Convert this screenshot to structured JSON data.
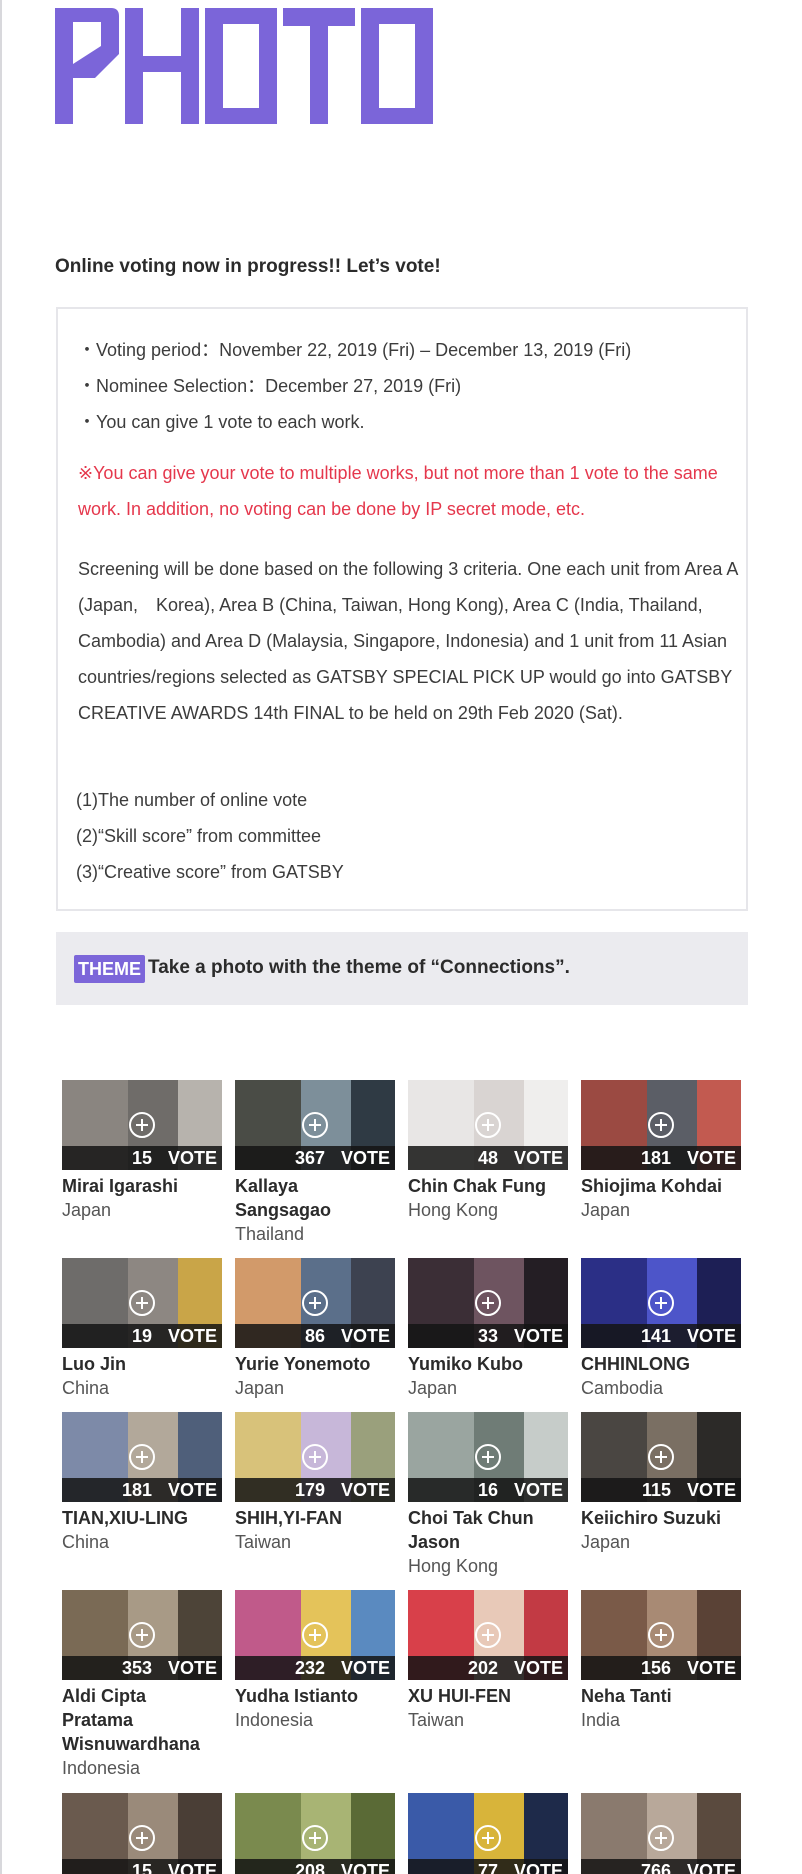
{
  "header": {
    "logo_text": "PHOTO",
    "logo_color": "#7b65d9"
  },
  "intro_text": "Online voting now in progress!! Let’s vote!",
  "info": {
    "period": "・Voting period：November 22, 2019 (Fri) – December 13, 2019 (Fri)",
    "selection": "・Nominee Selection：December 27, 2019 (Fri)",
    "one_vote": "・You can give 1 vote to each work.",
    "warning": "※You can give your vote to multiple works, but not more than 1 vote to the same work. In addition, no voting can be done by IP secret mode, etc.",
    "screening": "Screening will be done based on the following 3 criteria. One each unit from Area A (Japan,　Korea), Area B (China, Taiwan, Hong Kong), Area C (India, Thailand, Cambodia) and Area D (Malaysia, Singapore, Indonesia) and 1 unit from 11 Asian countries/regions selected as GATSBY SPECIAL PICK UP would go into GATSBY CREATIVE AWARDS 14th FINAL to be held on 29th Feb 2020 (Sat).",
    "criteria": [
      "(1)The number of online vote",
      "(2)“Skill score” from committee",
      "(3)“Creative score” from GATSBY"
    ],
    "warning_color": "#e5374c"
  },
  "theme": {
    "tag": "THEME",
    "text": "Take a photo with the theme of “Connections”.",
    "tag_color": "#7c66d9"
  },
  "vote_label": "VOTE",
  "entries": [
    {
      "name": "Mirai Igarashi",
      "country": "Japan",
      "votes": "15",
      "colors": [
        "#8a8580",
        "#6f6c69",
        "#b7b3ad"
      ]
    },
    {
      "name": "Kallaya Sangsagao",
      "country": "Thailand",
      "votes": "367",
      "colors": [
        "#4a4c46",
        "#7d8f9a",
        "#2f3a44"
      ]
    },
    {
      "name": "Chin Chak Fung",
      "country": "Hong Kong",
      "votes": "48",
      "colors": [
        "#e8e6e5",
        "#d9d4d2",
        "#efeeed"
      ]
    },
    {
      "name": "Shiojima Kohdai",
      "country": "Japan",
      "votes": "181",
      "colors": [
        "#9b4a42",
        "#5b5e66",
        "#c25a50"
      ]
    },
    {
      "name": "Luo Jin",
      "country": "China",
      "votes": "19",
      "colors": [
        "#6e6c6a",
        "#8d8782",
        "#c9a548"
      ]
    },
    {
      "name": "Yurie Yonemoto",
      "country": "Japan",
      "votes": "86",
      "colors": [
        "#d29a6a",
        "#5b6f8a",
        "#3d4250"
      ]
    },
    {
      "name": "Yumiko Kubo",
      "country": "Japan",
      "votes": "33",
      "colors": [
        "#3b2e36",
        "#6e5460",
        "#241e24"
      ]
    },
    {
      "name": "CHHINLONG",
      "country": "Cambodia",
      "votes": "141",
      "colors": [
        "#2b2f86",
        "#4d55c9",
        "#1d1f55"
      ]
    },
    {
      "name": "TIAN,XIU-LING",
      "country": "China",
      "votes": "181",
      "colors": [
        "#7d8aa8",
        "#b2a89a",
        "#4f5f7a"
      ]
    },
    {
      "name": "SHIH,YI-FAN",
      "country": "Taiwan",
      "votes": "179",
      "colors": [
        "#d8c27a",
        "#c7b7d9",
        "#9aa07c"
      ]
    },
    {
      "name": "Choi Tak Chun Jason",
      "country": "Hong Kong",
      "votes": "16",
      "colors": [
        "#9aa5a0",
        "#6f7c76",
        "#c6ccc9"
      ]
    },
    {
      "name": "Keiichiro Suzuki",
      "country": "Japan",
      "votes": "115",
      "colors": [
        "#4a4642",
        "#7a6f63",
        "#2c2a28"
      ]
    },
    {
      "name": "Aldi Cipta Pratama Wisnuwardhana",
      "country": "Indonesia",
      "votes": "353",
      "colors": [
        "#7a6a55",
        "#a89a86",
        "#4d4438"
      ]
    },
    {
      "name": "Yudha Istianto",
      "country": "Indonesia",
      "votes": "232",
      "colors": [
        "#c05a8a",
        "#e4c35a",
        "#5a8ac0"
      ]
    },
    {
      "name": "XU HUI-FEN",
      "country": "Taiwan",
      "votes": "202",
      "colors": [
        "#d8404a",
        "#e8c9b8",
        "#c23a44"
      ]
    },
    {
      "name": "Neha Tanti",
      "country": "India",
      "votes": "156",
      "colors": [
        "#7a5a48",
        "#a88a74",
        "#5a4236"
      ]
    },
    {
      "name": "",
      "country": "",
      "votes": "15",
      "colors": [
        "#6a5a4e",
        "#9a8a7a",
        "#4a3e36"
      ]
    },
    {
      "name": "",
      "country": "",
      "votes": "208",
      "colors": [
        "#7a8a4e",
        "#a8b474",
        "#5a6a36"
      ]
    },
    {
      "name": "",
      "country": "",
      "votes": "77",
      "colors": [
        "#3a5aa8",
        "#d8b43a",
        "#1e2a4a"
      ]
    },
    {
      "name": "",
      "country": "",
      "votes": "766",
      "colors": [
        "#8a7a6e",
        "#b8a89a",
        "#5a4a3e"
      ]
    }
  ]
}
